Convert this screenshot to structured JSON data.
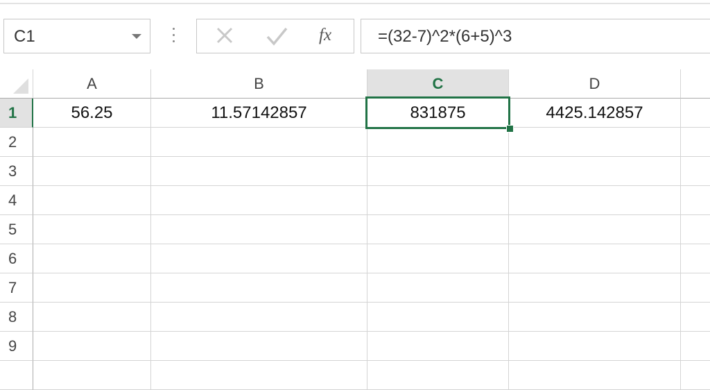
{
  "formula_bar": {
    "name_box": "C1",
    "formula": "=(32-7)^2*(6+5)^3",
    "fx_label": "fx"
  },
  "columns": [
    "A",
    "B",
    "C",
    "D"
  ],
  "active_column": "C",
  "rows": [
    "1",
    "2",
    "3",
    "4",
    "5",
    "6",
    "7",
    "8",
    "9"
  ],
  "active_row": "1",
  "cells": {
    "A1": "56.25",
    "B1": "11.57142857",
    "C1": "831875",
    "D1": "4425.142857"
  },
  "colors": {
    "accent": "#217346",
    "header_active_bg": "#e2e2e2",
    "gridline": "#d4d4d4"
  }
}
